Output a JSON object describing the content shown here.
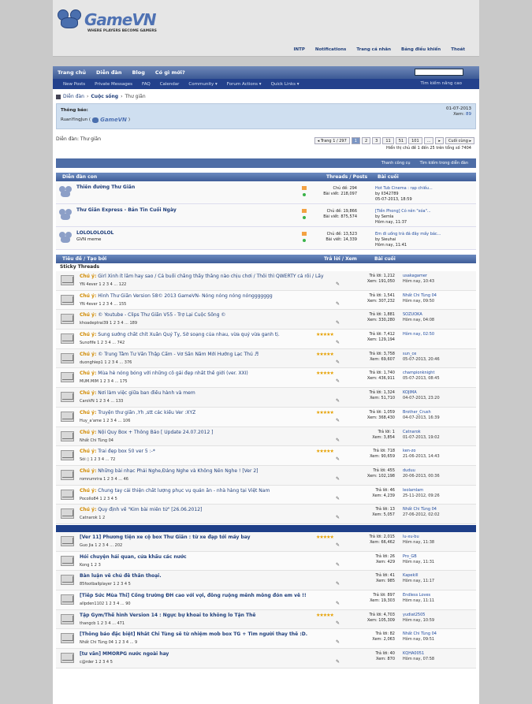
{
  "header": {
    "logo_title": "GameVN",
    "logo_tagline": "WHERE PLAYERS BECOME GAMERS",
    "top_links": [
      "INTP",
      "Notifications",
      "Trang cá nhân",
      "Bảng điều khiển",
      "Thoát"
    ]
  },
  "nav": {
    "main": [
      "Trang chủ",
      "Diễn đàn",
      "Blog",
      "Có gì mới?"
    ],
    "sub": [
      "New Posts",
      "Private Messages",
      "FAQ",
      "Calendar",
      "Community ▾",
      "Forum Actions ▾",
      "Quick Links ▾"
    ],
    "advanced_search": "Tìm kiếm nâng cao"
  },
  "breadcrumb": {
    "items": [
      "Diễn đàn",
      "Cuộc sống",
      "Thư giãn"
    ]
  },
  "notice": {
    "label": "Thông báo:",
    "user": "RuanYingJun (",
    "logo": "GameVN",
    ")close": ")",
    "date": "01-07-2013",
    "views_label": "Xem:",
    "views": "89"
  },
  "forum_label": "Diễn đàn: Thư giãn",
  "pager": {
    "items": [
      "◂ Trang 1 / 297",
      "1",
      "2",
      "3",
      "11",
      "51",
      "101",
      "...",
      "▸",
      "Cuối cùng ▸"
    ],
    "showing": "Hiển thị chủ đề 1 đến 25 trên tổng số 7404"
  },
  "toolsbar": [
    "Thanh công cụ",
    "Tìm kiếm trong diễn đàn"
  ],
  "subforums": {
    "header_left": "Diễn đàn con",
    "header_mid": "Threads / Posts",
    "header_right": "Bài cuối",
    "items": [
      {
        "name": "Thiên đường Thư Giãn",
        "desc": "",
        "stats": [
          "Chủ đề: 294",
          "Bài viết: 218,097"
        ],
        "last": [
          "Hot Tub Cinema : rạp chiếu...",
          "by ll342789",
          "05-07-2013, 18:59"
        ]
      },
      {
        "name": "Thư Giãn Express - Bản Tin Cuối Ngày",
        "desc": "",
        "stats": [
          "Chủ đề: 19,866",
          "Bài viết: 875,574"
        ],
        "last": [
          "[Tiền Phong] Có nên \"xóa\"...",
          "by Semla",
          "Hôm nay, 11:37"
        ]
      },
      {
        "name": "LOLOLOLOLOL",
        "desc": "GVN meme",
        "stats": [
          "Chủ đề: 13,523",
          "Bài viết: 14,339"
        ],
        "last": [
          "Em đi uống trà đá đây mấy bác...",
          "by Sieuhai",
          "Hôm nay, 11:41"
        ]
      }
    ]
  },
  "threads": {
    "header_left": "Tiêu đề / Tạo bởi",
    "header_mid": "Trả lời / Xem",
    "header_right": "Bài cuối",
    "sticky_label": "Sticky Threads",
    "sticky": [
      {
        "prefix": "Chú ý:",
        "title": "Girl Xinh ít lắm hay sao / Cả buổi chẳng thấy thằng nào chịu chơi / Thôi thì QWERTY cả rồi / Lấy bịch khăn giấy em mới các anh",
        "author": "YN 4ever",
        "pages": "1 2 3 4 ... 122",
        "stars": "",
        "r": "Trả lời: 1,212",
        "v": "Xem: 191,050",
        "lu": "usakagamer",
        "ld": "Hôm nay, 10:43"
      },
      {
        "prefix": "Chú ý:",
        "title": "Hình Thư Giãn Version 58© 2013 GameVN- Nóng nóng nóng nónggggggg",
        "author": "YN 4ever",
        "pages": "1 2 3 4 ... 155",
        "stars": "",
        "r": "Trả lời: 1,541",
        "v": "Xem: 307,232",
        "lu": "Nhất Chi Tùng 04",
        "ld": "Hôm nay, 09:50"
      },
      {
        "prefix": "Chú ý:",
        "title": "© Youtube - Clips Thư Giãn V55 - Trợ Lại Cuộc Sống ©",
        "author": "khoadeptrai39",
        "pages": "1 2 3 4 ... 189",
        "stars": "",
        "r": "Trả lời: 1,881",
        "v": "Xem: 330,280",
        "lu": "SOZUOKA",
        "ld": "Hôm nay, 04:08"
      },
      {
        "prefix": "Chú ý:",
        "title": "Sung sướng chất chít Xuân Quý Tỵ, Sờ soạng của nhau, vừa quý vừa ganh tị.",
        "author": "Sunofife",
        "pages": "1 2 3 4 ... 742",
        "stars": "★★★★★",
        "r": "Trả lời: 7,412",
        "v": "Xem: 129,194",
        "lu": "Hôm nay, 02:50",
        "ld": ""
      },
      {
        "prefix": "Chú ý:",
        "title": "© Trung Tâm Tư Vấn Thập Cẩm - Vơ Sần Năm Mới Hướng Lạc Thú ♬",
        "author": "duonghiep1",
        "pages": "1 2 3 4 ... 376",
        "stars": "★★★★★",
        "r": "Trả lời: 3,758",
        "v": "Xem: 69,607",
        "lu": "sun_ce",
        "ld": "05-07-2013, 20:46"
      },
      {
        "prefix": "Chú ý:",
        "title": "Mùa hè nóng bỏng với những cô gái đẹp nhất thế giới (ver. XXI)",
        "author": "MUM.MIM",
        "pages": "1 2 3 4 ... 175",
        "stars": "★★★★★",
        "r": "Trả lời: 1,740",
        "v": "Xem: 436,911",
        "lu": "championknight",
        "ld": "05-07-2013, 08:45"
      },
      {
        "prefix": "Chú ý:",
        "title": "Nơi làm việc giữa ban điều hành và mem",
        "author": "CaroVN",
        "pages": "1 2 3 4 ... 133",
        "stars": "",
        "r": "Trả lời: 1,324",
        "v": "Xem: 51,710",
        "lu": "KOJIMA",
        "ld": "04-07-2013, 23:20"
      },
      {
        "prefix": "Chú ý:",
        "title": "Truyện thư giãn ,Yh ,stt các kiểu Ver :XYZ",
        "author": "Huy_a'ame",
        "pages": "1 2 3 4 ... 106",
        "stars": "★★★★★",
        "r": "Trả lời: 1,059",
        "v": "Xem: 368,430",
        "lu": "Brother_Crush",
        "ld": "04-07-2013, 16:39"
      },
      {
        "prefix": "Chú ý:",
        "title": "Nội Quy Box + Thông Báo [ Update 24.07.2012 ]",
        "author": "Nhất Chi Tùng 04",
        "pages": "",
        "stars": "",
        "r": "Trả lời: 1",
        "v": "Xem: 3,854",
        "lu": "Catnarok",
        "ld": "01-07-2013, 19:02"
      },
      {
        "prefix": "Chú ý:",
        "title": "Trai đẹp box 50 ver 5 :-*",
        "author": "Sói ▯",
        "pages": "1 2 3 4 ... 72",
        "stars": "★★★★★",
        "r": "Trả lời: 718",
        "v": "Xem: 90,659",
        "lu": "ken-zo",
        "ld": "21-06-2013, 14:43"
      },
      {
        "prefix": "Chú ý:",
        "title": "Những bài nhạc Phải Nghe,Đáng Nghe và Không Nên Nghe ! [Ver 2]",
        "author": "romrumrira",
        "pages": "1 2 3 4 ... 46",
        "stars": "",
        "r": "Trả lời: 455",
        "v": "Xem: 102,198",
        "lu": "duduu",
        "ld": "20-06-2013, 00:36"
      },
      {
        "prefix": "Chú ý:",
        "title": "Chung tay cải thiện chất lượng phục vụ quán ăn - nhà hàng tại Việt Nam",
        "author": "Pocollo84",
        "pages": "1 2 3 4 5",
        "stars": "",
        "r": "Trả lời: 46",
        "v": "Xem: 4,239",
        "lu": "leolamlam",
        "ld": "25-11-2012, 09:26"
      },
      {
        "prefix": "Chú ý:",
        "title": "Quy định về \"Kim bài miễn tử\" [26.06.2012]",
        "author": "Catnarok",
        "pages": "1 2",
        "stars": "",
        "r": "Trả lời: 13",
        "v": "Xem: 5,057",
        "lu": "Nhất Chi Tùng 04",
        "ld": "27-06-2012, 02:02"
      }
    ],
    "normal": [
      {
        "title": "[Ver 11] Phương tiện xe cộ box Thư Giãn : từ xe đạp tới máy bay",
        "author": "Guo Jia",
        "pages": "1 2 3 4 ... 202",
        "stars": "★★★★★",
        "r": "Trả lời: 2,015",
        "v": "Xem: 66,462",
        "lu": "lu-xu-bu",
        "ld": "Hôm nay, 11:38"
      },
      {
        "title": "Hỏi chuyện hải quan, cửa khẩu các nước",
        "author": "Kong",
        "pages": "1 2 3",
        "stars": "",
        "r": "Trả lời: 26",
        "v": "Xem: 429",
        "lu": "Pro_GB",
        "ld": "Hôm nay, 11:31"
      },
      {
        "title": "Bàn luận về chủ đề thần thoại.",
        "author": "85footballplayer",
        "pages": "1 2 3 4 5",
        "stars": "",
        "r": "Trả lời: 41",
        "v": "Xem: 985",
        "lu": "Kapekill",
        "ld": "Hôm nay, 11:17"
      },
      {
        "title": "[Tiếp Sức Mùa Thi] Cổng trường ĐH cao với vợi, đồng ruộng mênh mông đón em về !!",
        "author": "allpden1102",
        "pages": "1 2 3 4 ... 90",
        "stars": "",
        "r": "Trả lời: 897",
        "v": "Xem: 19,303",
        "lu": "Endless Loves",
        "ld": "Hôm nay, 11:11"
      },
      {
        "title": "Tập Gym/Thể hình Version 14 : Ngực bự khoai to không lo Tận Thế",
        "author": "thangcb",
        "pages": "1 2 3 4 ... 471",
        "stars": "★★★★★",
        "r": "Trả lời: 4,703",
        "v": "Xem: 105,309",
        "lu": "yudiat2505",
        "ld": "Hôm nay, 10:59"
      },
      {
        "title": "[Thông báo đặc biệt] Nhất Chi Tùng sẽ từ nhiệm mob box TG + Tìm người thay thế :D.",
        "author": "Nhất Chi Tùng 04",
        "pages": "1 2 3 4 ... 9",
        "stars": "",
        "r": "Trả lời: 82",
        "v": "Xem: 2,063",
        "lu": "Nhất Chi Tùng 04",
        "ld": "Hôm nay, 09:51"
      },
      {
        "title": "[tư vấn] MMORPG nước ngoài hay",
        "author": "c@rder",
        "pages": "1 2 3 4 5",
        "stars": "",
        "r": "Trả lời: 40",
        "v": "Xem: 870",
        "lu": "KQHA0051",
        "ld": "Hôm nay, 07:58"
      }
    ]
  }
}
